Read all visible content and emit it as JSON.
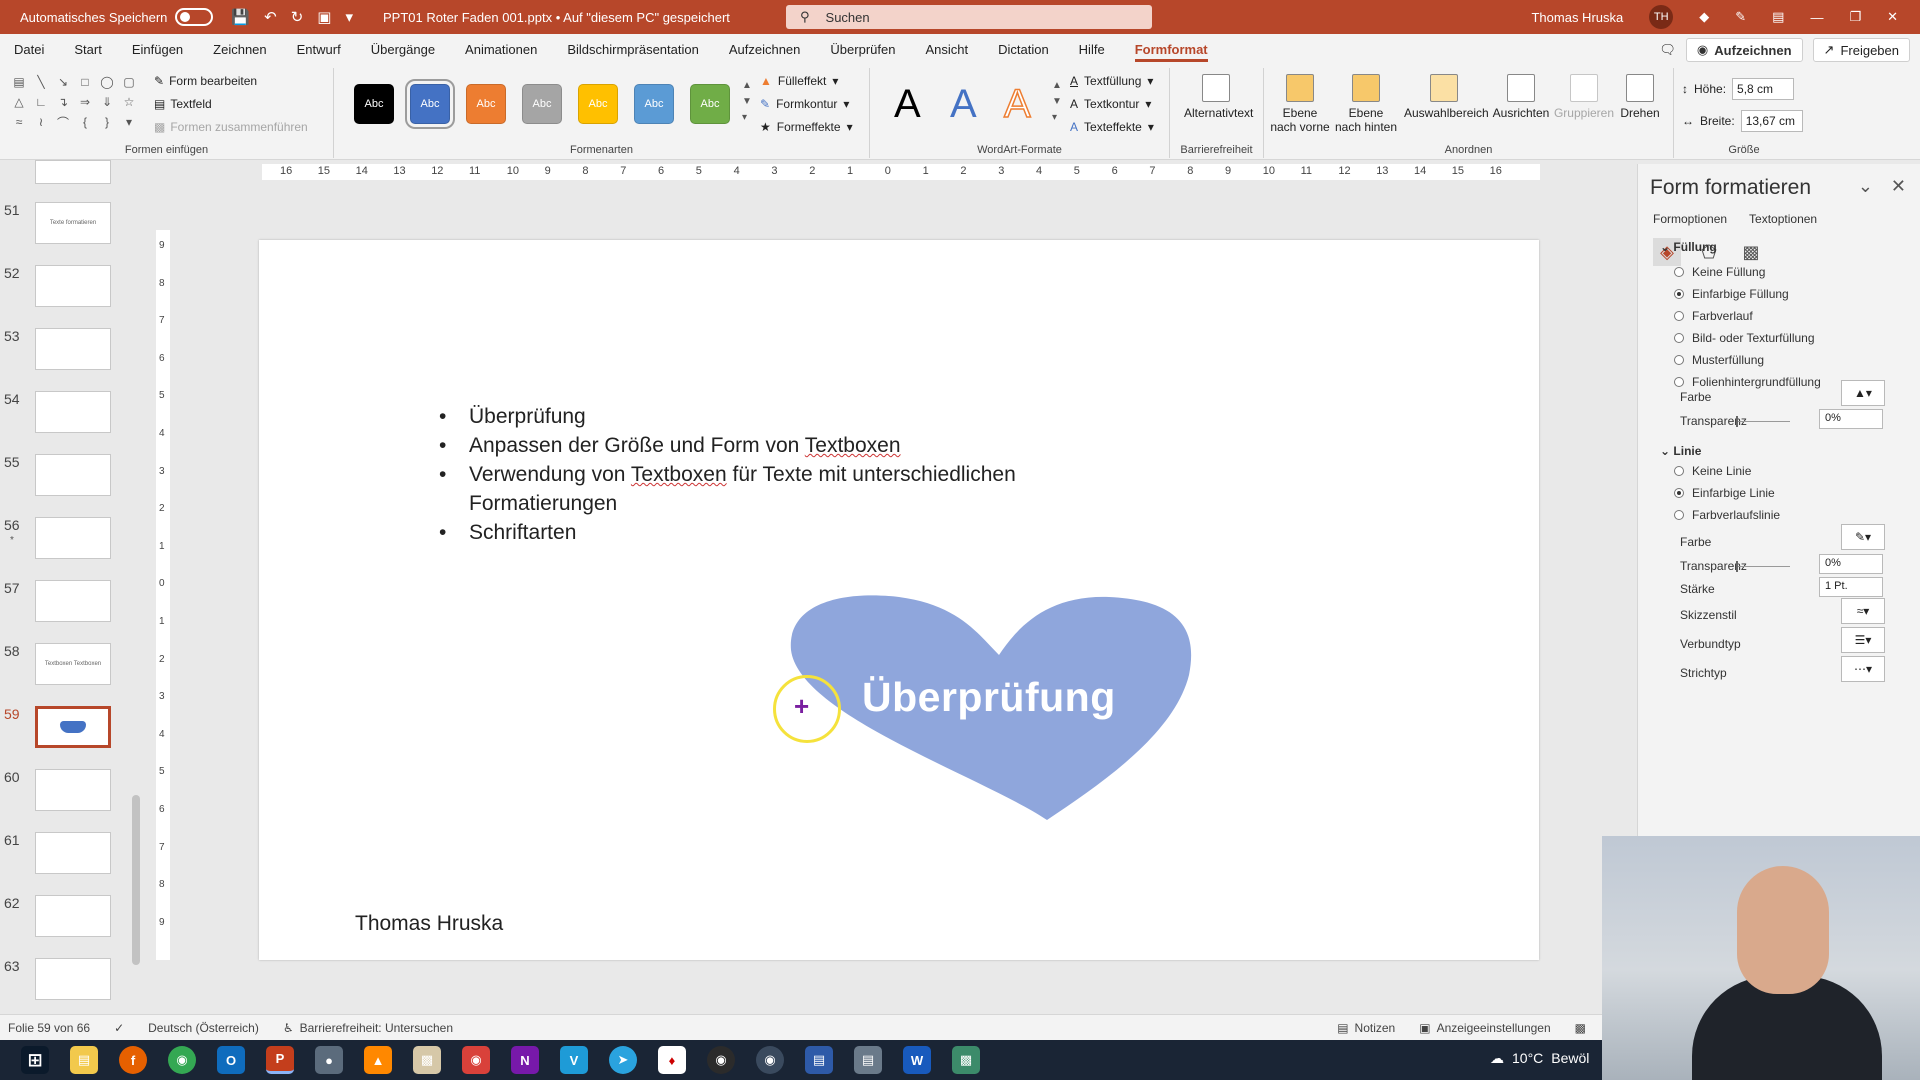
{
  "titlebar": {
    "autosave_label": "Automatisches Speichern",
    "doc_title": "PPT01 Roter Faden 001.pptx • Auf \"diesem PC\" gespeichert",
    "search_placeholder": "Suchen",
    "user_name": "Thomas Hruska",
    "user_initials": "TH"
  },
  "menu": {
    "tabs": [
      "Datei",
      "Start",
      "Einfügen",
      "Zeichnen",
      "Entwurf",
      "Übergänge",
      "Animationen",
      "Bildschirmpräsentation",
      "Aufzeichnen",
      "Überprüfen",
      "Ansicht",
      "Dictation",
      "Hilfe",
      "Formformat"
    ],
    "record_label": "Aufzeichnen",
    "share_label": "Freigeben"
  },
  "ribbon": {
    "insert_shapes": {
      "label": "Formen einfügen",
      "edit_shape": "Form bearbeiten",
      "textbox": "Textfeld",
      "merge_shapes": "Formen zusammenführen"
    },
    "shape_styles": {
      "label": "Formenarten",
      "swatch_text": "Abc",
      "swatches": [
        "#000000",
        "#4472c4",
        "#ed7d31",
        "#a5a5a5",
        "#ffc000",
        "#5b9bd5",
        "#70ad47"
      ],
      "fill": "Fülleffekt",
      "outline": "Formkontur",
      "effects": "Formeffekte"
    },
    "wordart": {
      "label": "WordArt-Formate",
      "letter": "A",
      "text_fill": "Textfüllung",
      "text_outline": "Textkontur",
      "text_effects": "Texteffekte"
    },
    "accessibility": {
      "label": "Barrierefreiheit",
      "alt_text": "Alternativtext"
    },
    "arrange": {
      "label": "Anordnen",
      "bring_forward": "Ebene nach vorne",
      "send_backward": "Ebene nach hinten",
      "selection_pane": "Auswahlbereich",
      "align": "Ausrichten",
      "group": "Gruppieren",
      "rotate": "Drehen"
    },
    "size": {
      "label": "Größe",
      "height_label": "Höhe:",
      "height_value": "5,8 cm",
      "width_label": "Breite:",
      "width_value": "13,67 cm"
    }
  },
  "thumbnails": [
    {
      "num": "51",
      "caption": "Texte formatieren"
    },
    {
      "num": "52",
      "caption": ""
    },
    {
      "num": "53",
      "caption": ""
    },
    {
      "num": "54",
      "caption": ""
    },
    {
      "num": "55",
      "caption": ""
    },
    {
      "num": "56",
      "caption": "",
      "star": "*"
    },
    {
      "num": "57",
      "caption": ""
    },
    {
      "num": "58",
      "caption": "Textboxen Textboxen"
    },
    {
      "num": "59",
      "caption": "",
      "active": true
    },
    {
      "num": "60",
      "caption": ""
    },
    {
      "num": "61",
      "caption": ""
    },
    {
      "num": "62",
      "caption": ""
    },
    {
      "num": "63",
      "caption": ""
    }
  ],
  "ruler": {
    "h_ticks": [
      "16",
      "15",
      "14",
      "13",
      "12",
      "11",
      "10",
      "9",
      "8",
      "7",
      "6",
      "5",
      "4",
      "3",
      "2",
      "1",
      "0",
      "1",
      "2",
      "3",
      "4",
      "5",
      "6",
      "7",
      "8",
      "9",
      "10",
      "11",
      "12",
      "13",
      "14",
      "15",
      "16"
    ],
    "v_ticks": [
      "9",
      "8",
      "7",
      "6",
      "5",
      "4",
      "3",
      "2",
      "1",
      "0",
      "1",
      "2",
      "3",
      "4",
      "5",
      "6",
      "7",
      "8",
      "9"
    ]
  },
  "slide": {
    "bullets": [
      {
        "text": "Überprüfung"
      },
      {
        "pre": "Anpassen der Größe und Form von ",
        "spell": "Textboxen",
        "post": ""
      },
      {
        "pre": "Verwendung von ",
        "spell": "Textboxen",
        "post": " für Texte mit unterschiedlichen Formatierungen"
      },
      {
        "text": "Schriftarten"
      }
    ],
    "heart_text": "Überprüfung",
    "heart_color": "#8fa6dc",
    "author": "Thomas Hruska"
  },
  "format_pane": {
    "title": "Form formatieren",
    "tab_shape": "Formoptionen",
    "tab_text": "Textoptionen",
    "fill_section": "Füllung",
    "fill_options": [
      "Keine Füllung",
      "Einfarbige Füllung",
      "Farbverlauf",
      "Bild- oder Texturfüllung",
      "Musterfüllung",
      "Folienhintergrundfüllung"
    ],
    "fill_checked": 1,
    "color_label": "Farbe",
    "transparency_label": "Transparenz",
    "transparency_value": "0%",
    "line_section": "Linie",
    "line_options": [
      "Keine Linie",
      "Einfarbige Linie",
      "Farbverlaufslinie"
    ],
    "line_checked": 1,
    "line_color_label": "Farbe",
    "line_transparency_label": "Transparenz",
    "line_transparency_value": "0%",
    "width_label": "Stärke",
    "width_value": "1 Pt.",
    "sketch_label": "Skizzenstil",
    "compound_label": "Verbundtyp",
    "dash_label": "Strichtyp"
  },
  "statusbar": {
    "slide_info": "Folie 59 von 66",
    "language": "Deutsch (Österreich)",
    "accessibility": "Barrierefreiheit: Untersuchen",
    "notes": "Notizen",
    "display_settings": "Anzeigeeinstellungen"
  },
  "taskbar": {
    "weather_temp": "10°C",
    "weather_text": "Bewöl"
  }
}
